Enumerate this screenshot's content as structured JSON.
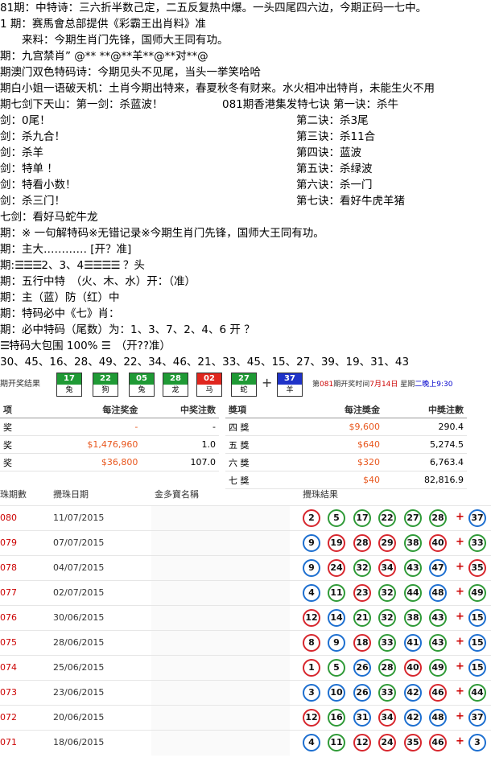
{
  "top_lines": [
    "81期：中特诗：三六折半数己定，二五反复热中爆。一头四尾四六边，今期正码一七中。",
    "1 期：赛馬會总部提供《彩霸王出肖料》准",
    "　　来料：今期生肖门先锋，国师大王同有功。",
    "期：九宫禁肖”  @** **@**羊**@**对**@",
    "期澳门双色特码诗：今期见头不见尾，当头一挙笑哈哈",
    "期白小姐一语破天机：土肖今期出特来，春夏秋冬有财来。水火相冲出特肖，未能生火不用",
    "期七剑下天山：第一剑：杀蓝波！",
    "剑：0尾！",
    "剑：杀九合！",
    "剑：杀羊",
    "剑：特单 ！",
    "剑：特看小数！",
    "剑：杀三门！",
    "七剑：看好马蛇牛龙",
    "期：※ 一句解特码※无错记录※今期生肖门先锋，国师大王同有功。",
    "期：主大………… [开？准]",
    "2、3、4",
    "？头",
    "期：五行中特　（火、木、水）开：（准）",
    "期：主（蓝）防（红）中",
    "期：特码必中《七》肖：",
    "期：必中特码（尾数）为：1、3、7、2、4、6 开 ？",
    "特码大包围 100%",
    "（开??准）",
    " 30、45、16、28、49、22、34、46、21、33、45、15、27、39、19、31、43"
  ],
  "mid_line": "081期香港集发特七诀 第一诀：杀牛",
  "right_lines": [
    "第二诀：杀3尾",
    "第三诀：杀11合",
    "第四诀：蓝波",
    "第五诀：杀绿波",
    "第六诀：杀一门",
    "第七诀：看好牛虎羊猪"
  ],
  "result_bar": {
    "label": "期开奖结果",
    "balls": [
      {
        "num": "17",
        "zodiac": "兔",
        "color": "#1f9a35"
      },
      {
        "num": "22",
        "zodiac": "狗",
        "color": "#1f9a35"
      },
      {
        "num": "05",
        "zodiac": "兔",
        "color": "#1f9a35"
      },
      {
        "num": "28",
        "zodiac": "龙",
        "color": "#1f9a35"
      },
      {
        "num": "02",
        "zodiac": "马",
        "color": "#e0261e"
      },
      {
        "num": "27",
        "zodiac": "蛇",
        "color": "#1f9a35"
      }
    ],
    "special": {
      "num": "37",
      "zodiac": "羊",
      "color": "#1f33c8"
    },
    "plus": "+",
    "info_pre": "第",
    "info_issue": "081",
    "info_mid": "期开奖时间",
    "info_date": "7月14日",
    "info_week": " 星期",
    "info_day": "二晚上9:30"
  },
  "prize_left": {
    "headers": [
      "项",
      "每注奖金",
      "中奖注数"
    ],
    "rows": [
      {
        "name": "奖",
        "money": "-",
        "count": "-"
      },
      {
        "name": "奖",
        "money": "$1,476,960",
        "count": "1.0"
      },
      {
        "name": "奖",
        "money": "$36,800",
        "count": "107.0"
      }
    ]
  },
  "prize_right": {
    "headers": [
      "獎項",
      "每注獎金",
      "中獎注數"
    ],
    "rows": [
      {
        "name": "四 獎",
        "money": "$9,600",
        "count": "290.4"
      },
      {
        "name": "五 獎",
        "money": "$640",
        "count": "5,274.5"
      },
      {
        "name": "六 獎",
        "money": "$320",
        "count": "6,763.4"
      },
      {
        "name": "七 獎",
        "money": "$40",
        "count": "82,816.9"
      }
    ]
  },
  "draw_headers": {
    "issue": "珠期數",
    "date": "攪珠日期",
    "name": "金多寶名稱",
    "result": "攪珠結果"
  },
  "draws": [
    {
      "issue": "080",
      "date": "11/07/2015",
      "balls": [
        [
          "2",
          "red"
        ],
        [
          "5",
          "green"
        ],
        [
          "17",
          "green"
        ],
        [
          "22",
          "green"
        ],
        [
          "27",
          "green"
        ],
        [
          "28",
          "green"
        ]
      ],
      "special": [
        "37",
        "blue"
      ]
    },
    {
      "issue": "079",
      "date": "07/07/2015",
      "balls": [
        [
          "9",
          "blue"
        ],
        [
          "19",
          "red"
        ],
        [
          "28",
          "red"
        ],
        [
          "29",
          "red"
        ],
        [
          "38",
          "green"
        ],
        [
          "40",
          "red"
        ]
      ],
      "special": [
        "33",
        "green"
      ]
    },
    {
      "issue": "078",
      "date": "04/07/2015",
      "balls": [
        [
          "9",
          "blue"
        ],
        [
          "24",
          "red"
        ],
        [
          "32",
          "green"
        ],
        [
          "34",
          "red"
        ],
        [
          "43",
          "green"
        ],
        [
          "47",
          "blue"
        ]
      ],
      "special": [
        "35",
        "red"
      ]
    },
    {
      "issue": "077",
      "date": "02/07/2015",
      "balls": [
        [
          "4",
          "blue"
        ],
        [
          "11",
          "green"
        ],
        [
          "23",
          "red"
        ],
        [
          "32",
          "green"
        ],
        [
          "44",
          "green"
        ],
        [
          "48",
          "blue"
        ]
      ],
      "special": [
        "49",
        "green"
      ]
    },
    {
      "issue": "076",
      "date": "30/06/2015",
      "balls": [
        [
          "12",
          "red"
        ],
        [
          "14",
          "blue"
        ],
        [
          "21",
          "green"
        ],
        [
          "32",
          "green"
        ],
        [
          "38",
          "green"
        ],
        [
          "43",
          "green"
        ]
      ],
      "special": [
        "15",
        "blue"
      ]
    },
    {
      "issue": "075",
      "date": "28/06/2015",
      "balls": [
        [
          "8",
          "red"
        ],
        [
          "9",
          "blue"
        ],
        [
          "18",
          "red"
        ],
        [
          "33",
          "green"
        ],
        [
          "41",
          "blue"
        ],
        [
          "43",
          "green"
        ]
      ],
      "special": [
        "15",
        "blue"
      ]
    },
    {
      "issue": "074",
      "date": "25/06/2015",
      "balls": [
        [
          "1",
          "red"
        ],
        [
          "5",
          "green"
        ],
        [
          "26",
          "blue"
        ],
        [
          "28",
          "green"
        ],
        [
          "40",
          "red"
        ],
        [
          "49",
          "green"
        ]
      ],
      "special": [
        "15",
        "blue"
      ]
    },
    {
      "issue": "073",
      "date": "23/06/2015",
      "balls": [
        [
          "3",
          "blue"
        ],
        [
          "10",
          "blue"
        ],
        [
          "26",
          "blue"
        ],
        [
          "33",
          "green"
        ],
        [
          "42",
          "blue"
        ],
        [
          "46",
          "red"
        ]
      ],
      "special": [
        "44",
        "green"
      ]
    },
    {
      "issue": "072",
      "date": "20/06/2015",
      "balls": [
        [
          "12",
          "red"
        ],
        [
          "16",
          "green"
        ],
        [
          "31",
          "blue"
        ],
        [
          "34",
          "red"
        ],
        [
          "42",
          "blue"
        ],
        [
          "48",
          "blue"
        ]
      ],
      "special": [
        "37",
        "blue"
      ]
    },
    {
      "issue": "071",
      "date": "18/06/2015",
      "balls": [
        [
          "4",
          "blue"
        ],
        [
          "11",
          "green"
        ],
        [
          "12",
          "red"
        ],
        [
          "24",
          "red"
        ],
        [
          "35",
          "red"
        ],
        [
          "46",
          "red"
        ]
      ],
      "special": [
        "3",
        "blue"
      ]
    }
  ]
}
